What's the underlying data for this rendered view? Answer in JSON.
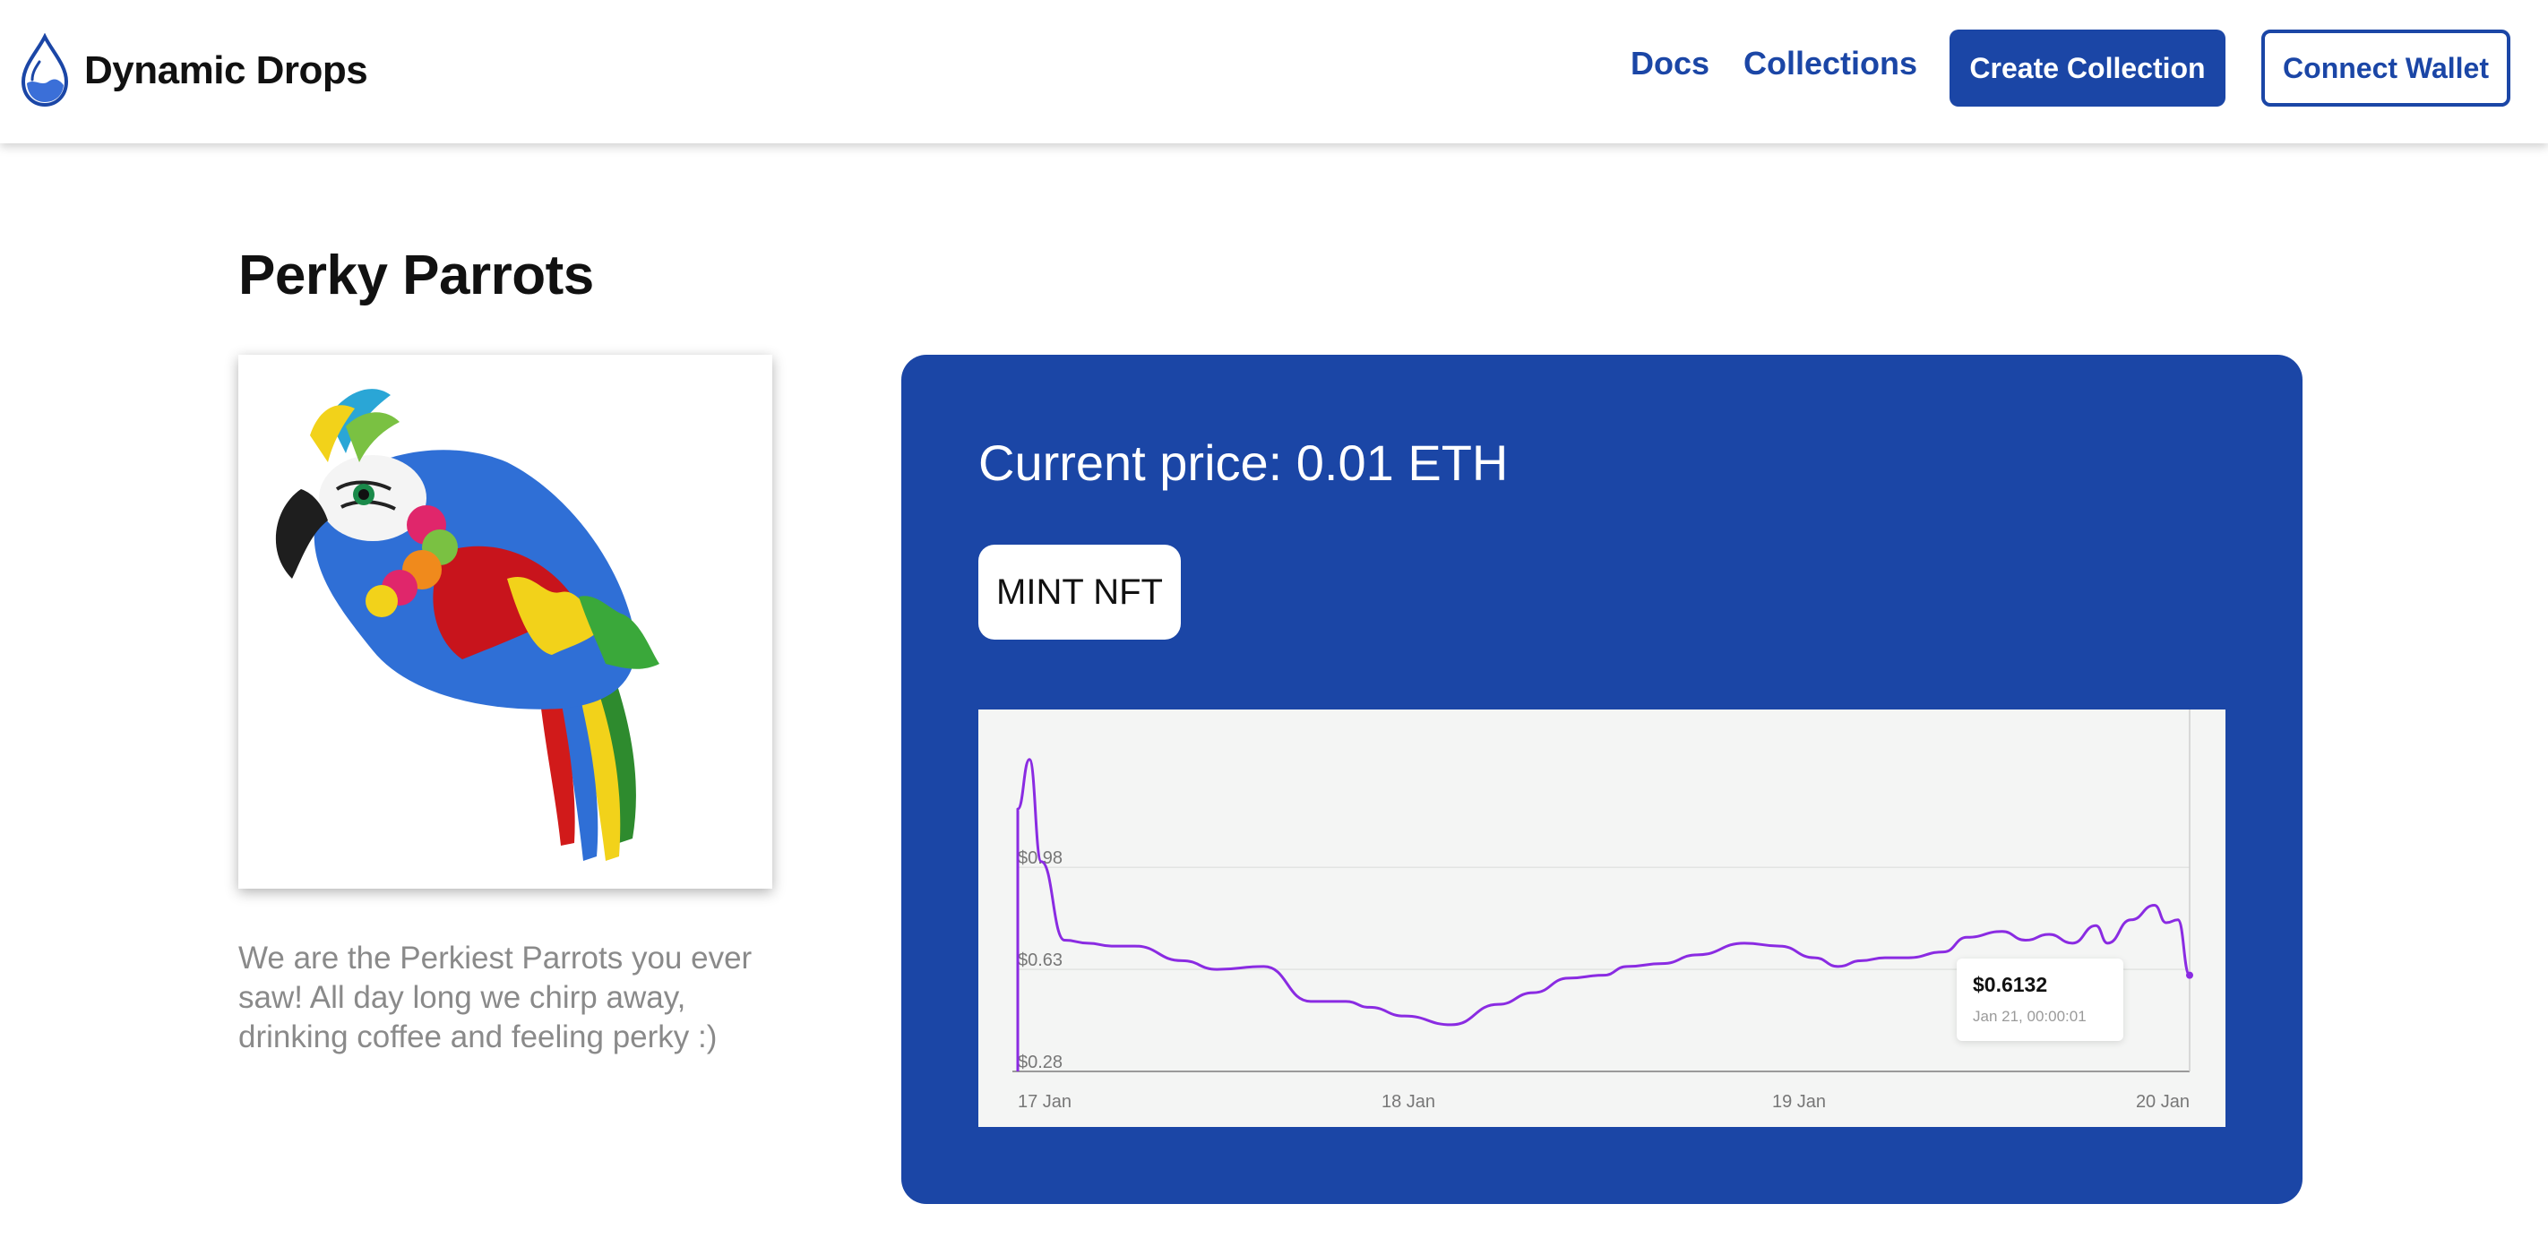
{
  "header": {
    "brand_name": "Dynamic Drops",
    "brand_icon": "water-drop-icon",
    "nav": {
      "docs_label": "Docs",
      "collections_label": "Collections"
    },
    "create_collection_label": "Create Collection",
    "connect_wallet_label": "Connect Wallet"
  },
  "colors": {
    "brand_blue": "#1b46a6",
    "chart_line": "#8a2be2",
    "description_gray": "#8a8a8a"
  },
  "collection": {
    "title": "Perky Parrots",
    "image_icon": "parrot-hat-image",
    "description": "We are the Perkiest Parrots you ever saw! All day long we chirp away, drinking coffee and feeling perky :)"
  },
  "price_panel": {
    "current_price": "Current price: 0.01 ETH",
    "mint_label": "MINT NFT"
  },
  "chart_data": {
    "type": "line",
    "title": "",
    "xlabel": "",
    "ylabel": "",
    "x_ticks": [
      "17 Jan",
      "18 Jan",
      "19 Jan",
      "20 Jan"
    ],
    "y_ticks": [
      "$0.28",
      "$0.63",
      "$0.98"
    ],
    "ylim": [
      0.28,
      1.46
    ],
    "grid": "horizontal",
    "series": [
      {
        "x": [
          0.0,
          0.01,
          0.02,
          0.04,
          0.06,
          0.08,
          0.1,
          0.14,
          0.17,
          0.21,
          0.25,
          0.28,
          0.3,
          0.33,
          0.37,
          0.41,
          0.44,
          0.47,
          0.5,
          0.52,
          0.55,
          0.58,
          0.62,
          0.65,
          0.68,
          0.7,
          0.72,
          0.74,
          0.76,
          0.79,
          0.81,
          0.84,
          0.86,
          0.88,
          0.9,
          0.92,
          0.93,
          0.95,
          0.97,
          0.98,
          0.99,
          1.0
        ],
        "values": [
          1.18,
          1.35,
          1.0,
          0.73,
          0.72,
          0.71,
          0.71,
          0.66,
          0.63,
          0.64,
          0.52,
          0.52,
          0.5,
          0.47,
          0.44,
          0.51,
          0.55,
          0.6,
          0.61,
          0.64,
          0.65,
          0.68,
          0.72,
          0.71,
          0.67,
          0.64,
          0.66,
          0.67,
          0.67,
          0.69,
          0.74,
          0.76,
          0.73,
          0.75,
          0.72,
          0.78,
          0.72,
          0.8,
          0.85,
          0.79,
          0.8,
          0.61
        ]
      }
    ],
    "tooltip": {
      "value": "$0.6132",
      "time": "Jan 21, 00:00:01"
    }
  }
}
